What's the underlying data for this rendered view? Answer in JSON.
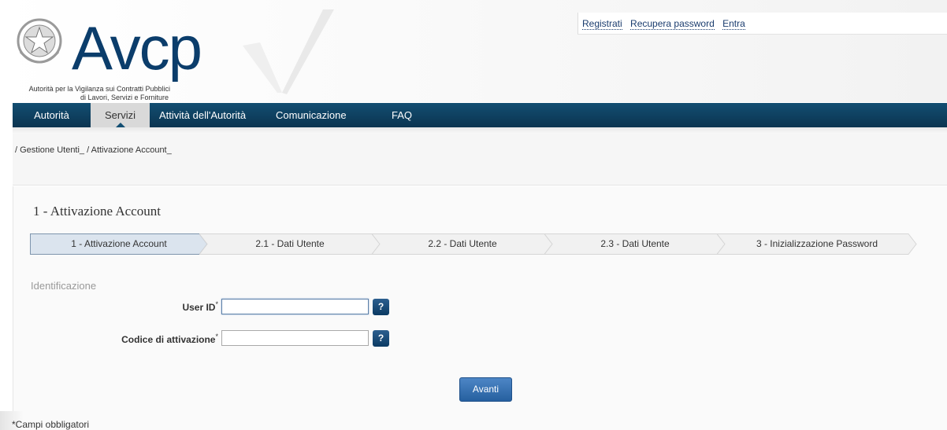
{
  "header": {
    "brand": "Avcp",
    "tagline_line1": "Autorità per la Vigilanza sui Contratti Pubblici",
    "tagline_line2": "di Lavori, Servizi e Forniture",
    "links": [
      "Registrati",
      "Recupera password",
      "Entra"
    ]
  },
  "nav": {
    "items": [
      "Autorità",
      "Servizi",
      "Attività dell'Autorità",
      "Comunicazione",
      "FAQ"
    ],
    "active": "Servizi"
  },
  "breadcrumb": "/ Gestione Utenti_ / Attivazione Account_",
  "page": {
    "title": "1 - Attivazione Account"
  },
  "wizard": {
    "steps": [
      "1 - Attivazione Account",
      "2.1 - Dati Utente",
      "2.2 - Dati Utente",
      "2.3 - Dati Utente",
      "3 - Inizializzazione Password"
    ],
    "current": "1 - Attivazione Account"
  },
  "form": {
    "section_title": "Identificazione",
    "fields": [
      {
        "label": "User ID",
        "required_mark": "*",
        "value": "",
        "help": "?"
      },
      {
        "label": "Codice di attivazione",
        "required_mark": "*",
        "value": "",
        "help": "?"
      }
    ],
    "submit_label": "Avanti",
    "required_note": "*Campi obbligatori"
  },
  "colors": {
    "nav_bg": "#0e3f5e",
    "brand": "#0b3d6b",
    "button": "#2f6aab",
    "help_button": "#1b4c7a"
  }
}
